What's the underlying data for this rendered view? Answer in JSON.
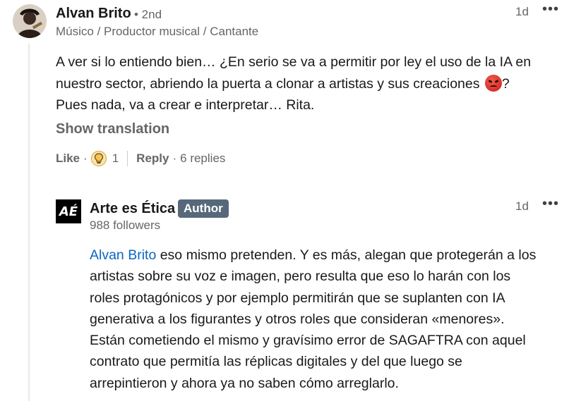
{
  "comment": {
    "author_name": "Alvan Brito",
    "degree": "• 2nd",
    "headline": "Músico / Productor musical / Cantante",
    "time": "1d",
    "more_icon": "ellipsis-icon",
    "body_lines": [
      "A ver si lo entiendo bien… ¿En serio se va a permitir por ley el uso de la IA en",
      "nuestro sector, abriendo la puerta a clonar a artistas y sus creaciones",
      "?",
      "Pues nada, va a crear e interpretar… Rita."
    ],
    "emoji": "angry-face",
    "show_translation": "Show translation",
    "like_label": "Like",
    "reaction_icon": "insightful-bulb-icon",
    "reaction_count": "1",
    "reply_label": "Reply",
    "replies_count": "6 replies"
  },
  "reply": {
    "logo_text": "AÉ",
    "author_name": "Arte es Ética",
    "badge": "Author",
    "followers": "988 followers",
    "time": "1d",
    "mention": "Alvan Brito",
    "first_line_rest": " eso mismo pretenden. Y es más, alegan que protegerán a los",
    "lines": [
      "artistas sobre su voz e imagen, pero resulta que eso lo harán con los",
      "roles protagónicos y por ejemplo permitirán que se suplanten con IA",
      "generativa a los figurantes y otros roles que consideran «menores».",
      "Están cometiendo el mismo y gravísimo error de SAGAFTRA con aquel",
      "contrato que permitía las réplicas digitales y del que luego se",
      "arrepintieron y ahora ya no saben cómo arreglarlo."
    ]
  }
}
